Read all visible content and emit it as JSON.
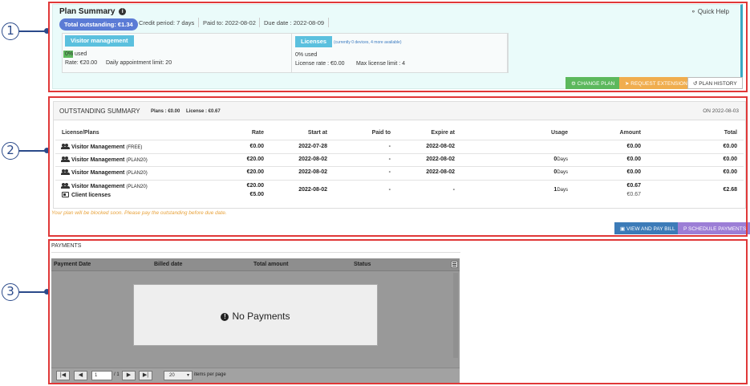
{
  "markers": [
    "1",
    "2",
    "3"
  ],
  "plan_summary": {
    "title": "Plan Summary",
    "quick_help": "Quick Help",
    "total_outstanding": "Total outstanding: €1.34",
    "credit_period": "Credit period: 7 days",
    "paid_to": "Paid to: 2022-08-02",
    "due_date": "Due date : 2022-08-09",
    "visitor": {
      "label": "Visitor management",
      "used": "0% used",
      "used_fraction": 0,
      "rate": "Rate: €20.00",
      "daily_limit": "Daily appointment limit: 20"
    },
    "licenses": {
      "label": "Licenses",
      "note": "(currently 0 devices, 4 more available)",
      "used": "0% used",
      "rate": "License rate : €0.00",
      "max": "Max license limit : 4"
    },
    "buttons": {
      "change_plan": "CHANGE PLAN",
      "request_extension": "REQUEST EXTENSION",
      "plan_history": "PLAN HISTORY"
    }
  },
  "outstanding": {
    "title": "OUTSTANDING SUMMARY",
    "plans_total": "Plans : €0.00",
    "license_total": "License : €0.67",
    "on_date": "ON 2022-08-03",
    "columns": [
      "License/Plans",
      "Rate",
      "Start at",
      "Paid to",
      "Expire at",
      "Usage",
      "Amount",
      "Total"
    ],
    "rows": [
      {
        "name": "Visitor Management",
        "tag": "(FREE)",
        "rate": "€0.00",
        "start": "2022-07-28",
        "paid_to": "-",
        "expire": "2022-08-02",
        "usage": "",
        "usage_unit": "",
        "amount": "€0.00",
        "total": "€0.00"
      },
      {
        "name": "Visitor Management",
        "tag": "(PLAN20)",
        "rate": "€20.00",
        "start": "2022-08-02",
        "paid_to": "-",
        "expire": "2022-08-02",
        "usage": "0",
        "usage_unit": "Days",
        "amount": "€0.00",
        "total": "€0.00"
      },
      {
        "name": "Visitor Management",
        "tag": "(PLAN20)",
        "rate": "€20.00",
        "start": "2022-08-02",
        "paid_to": "-",
        "expire": "2022-08-02",
        "usage": "0",
        "usage_unit": "Days",
        "amount": "€0.00",
        "total": "€0.00"
      }
    ],
    "combined_row": {
      "name": "Visitor Management",
      "tag": "(PLAN20)",
      "name2": "Client licenses",
      "rate": "€20.00",
      "rate2": "€5.00",
      "start": "2022-08-02",
      "paid_to": "-",
      "expire": "-",
      "usage": "1",
      "usage_unit": "Days",
      "amount": "€0.67",
      "amount2": "€0.67",
      "total": "€2.68"
    },
    "warning": "Your plan will be blocked soon. Please pay the outstanding before due date.",
    "buttons": {
      "view_pay": "VIEW AND PAY BILL",
      "schedule": "SCHEDULE PAYMENTS"
    }
  },
  "payments": {
    "title": "PAYMENTS",
    "columns": [
      "Payment Date",
      "Billed date",
      "Total amount",
      "Status"
    ],
    "empty": "No Payments",
    "pager": {
      "page": "1",
      "of": "/ 1",
      "per_page": "20",
      "per_page_label": "items per page"
    }
  }
}
